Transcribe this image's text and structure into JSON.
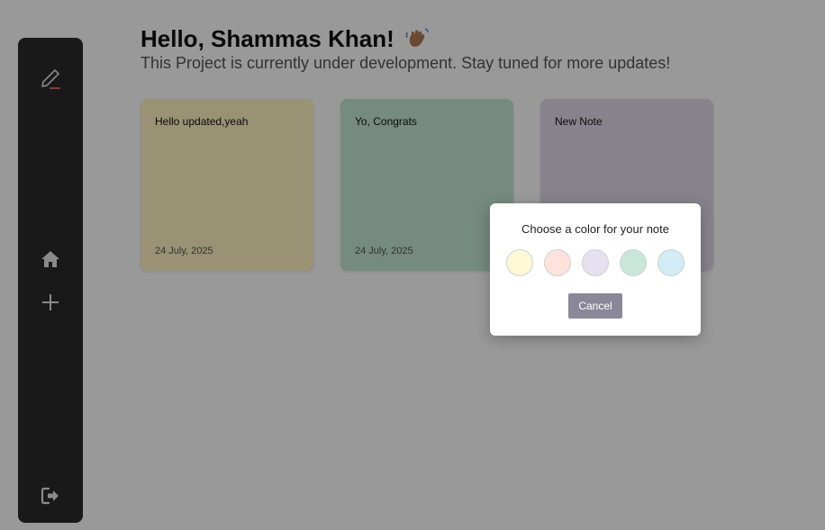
{
  "header": {
    "greeting": "Hello, Shammas Khan!",
    "subtitle": "This Project is currently under development. Stay tuned for more updates!"
  },
  "sidebar": {
    "items": [
      {
        "icon": "pen-logo-icon"
      },
      {
        "icon": "home-icon"
      },
      {
        "icon": "plus-icon"
      },
      {
        "icon": "logout-icon"
      }
    ]
  },
  "notes": [
    {
      "title": "Hello updated,yeah",
      "date": "24 July, 2025",
      "color": "#fff4c2"
    },
    {
      "title": "Yo, Congrats",
      "date": "24 July, 2025",
      "color": "#c3e6d8"
    },
    {
      "title": "New Note",
      "date": "",
      "color": "#e1dbe9"
    }
  ],
  "modal": {
    "title": "Choose a color for your note",
    "colors": [
      "#fff8d6",
      "#ffe2dc",
      "#e6e0ef",
      "#c8e6da",
      "#d2ecf5"
    ],
    "cancel_label": "Cancel"
  },
  "colors": {
    "sidebar_bg": "#2b2b2b",
    "cancel_bg": "#8a8799",
    "accent": "#e8735e"
  }
}
